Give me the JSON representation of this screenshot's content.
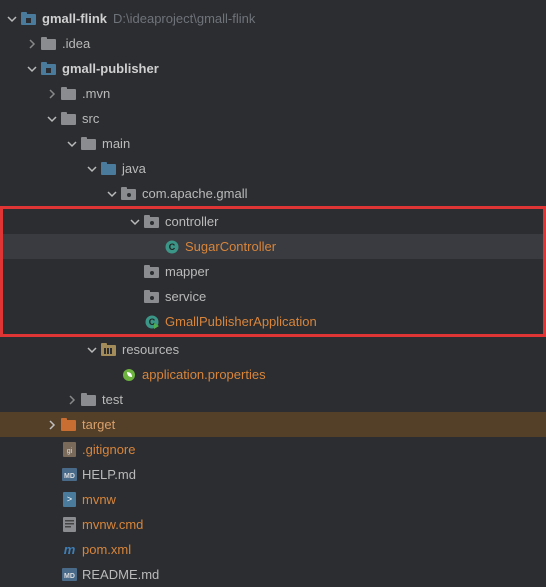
{
  "root": {
    "name": "gmall-flink",
    "path": "D:\\ideaproject\\gmall-flink"
  },
  "idea": ".idea",
  "publisher": "gmall-publisher",
  "mvn": ".mvn",
  "src": "src",
  "main": "main",
  "java": "java",
  "pkg": "com.apache.gmall",
  "controller": "controller",
  "sugar": "SugarController",
  "mapper": "mapper",
  "service": "service",
  "app": "GmallPublisherApplication",
  "resources": "resources",
  "appprops": "application.properties",
  "test": "test",
  "target": "target",
  "gitignore": ".gitignore",
  "help": "HELP.md",
  "mvnw": "mvnw",
  "mvnwcmd": "mvnw.cmd",
  "pom": "pom.xml",
  "readme": "README.md"
}
